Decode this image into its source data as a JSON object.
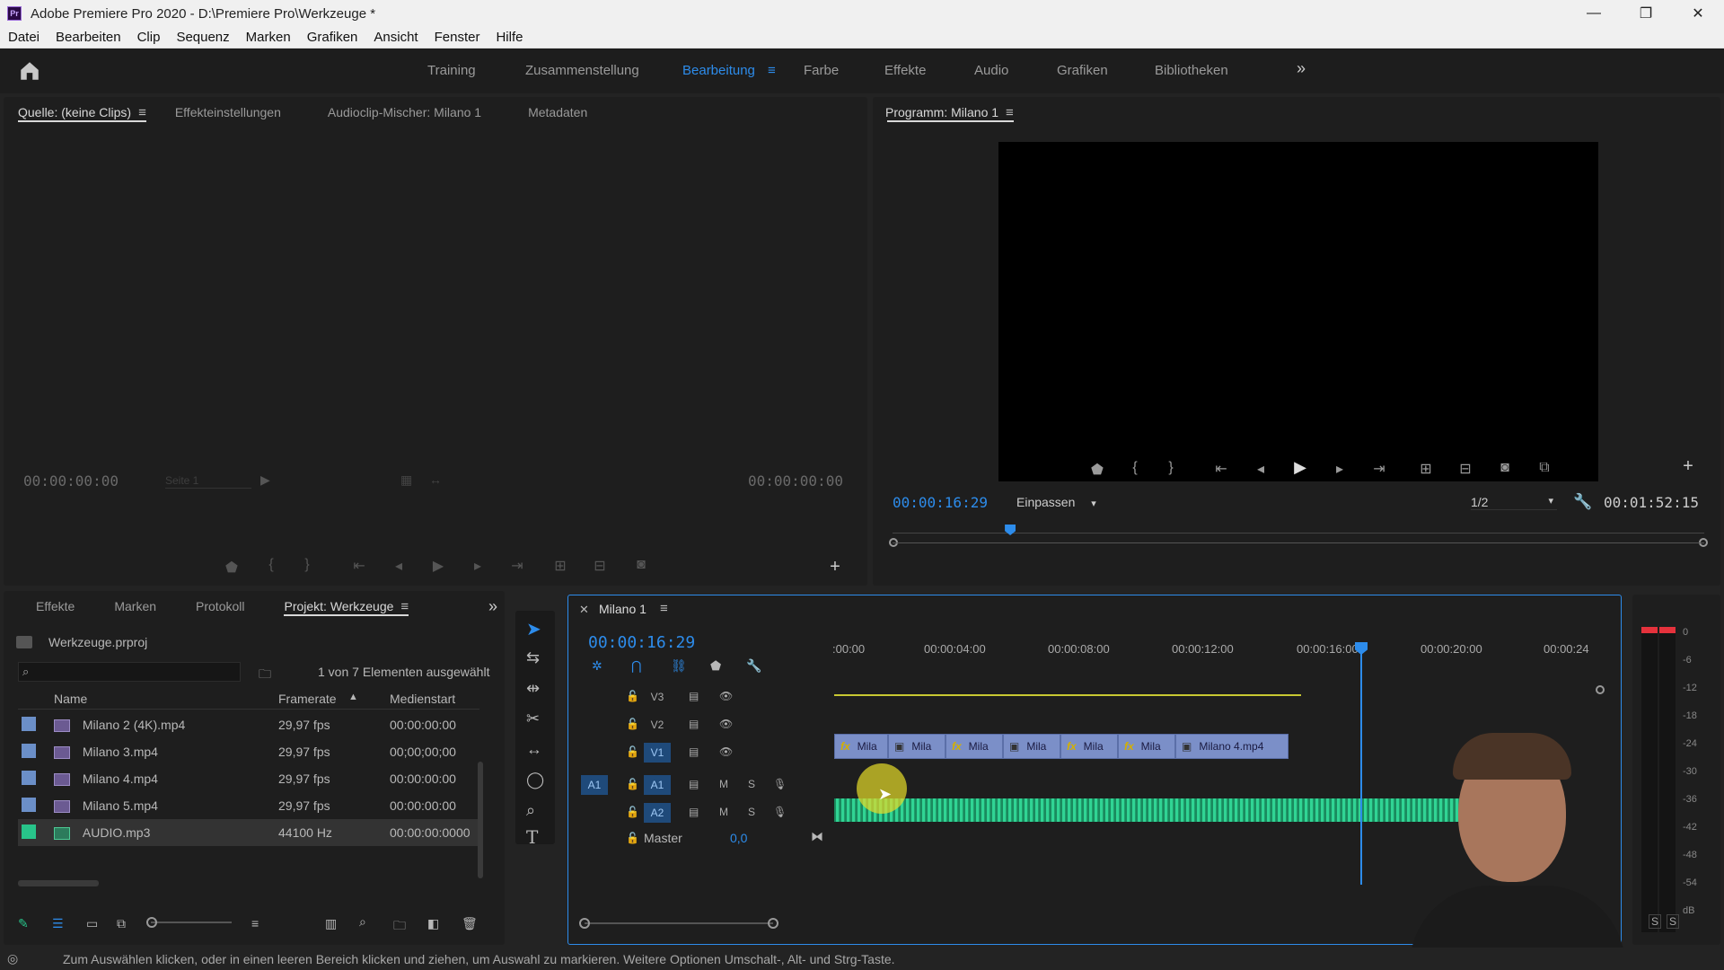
{
  "app": {
    "title": "Adobe Premiere Pro 2020 - D:\\Premiere Pro\\Werkzeuge *",
    "icon": "Pr"
  },
  "window_controls": {
    "minimize": "—",
    "maximize": "❐",
    "close": "✕"
  },
  "menu": [
    "Datei",
    "Bearbeiten",
    "Clip",
    "Sequenz",
    "Marken",
    "Grafiken",
    "Ansicht",
    "Fenster",
    "Hilfe"
  ],
  "workspaces": {
    "items": [
      "Training",
      "Zusammenstellung",
      "Bearbeitung",
      "Farbe",
      "Effekte",
      "Audio",
      "Grafiken",
      "Bibliotheken"
    ],
    "active": "Bearbeitung",
    "overflow": "»"
  },
  "source_panel": {
    "tabs": [
      "Quelle: (keine Clips)",
      "Effekteinstellungen",
      "Audioclip-Mischer: Milano 1",
      "Metadaten"
    ],
    "timecode_left": "00:00:00:00",
    "page_label": "Seite 1",
    "timecode_right": "00:00:00:00"
  },
  "program_panel": {
    "title": "Programm: Milano 1",
    "timecode": "00:00:16:29",
    "fit": "Einpassen",
    "resolution": "1/2",
    "duration": "00:01:52:15",
    "playhead_fraction": 0.145
  },
  "project_panel": {
    "tabs": [
      "Effekte",
      "Marken",
      "Protokoll",
      "Projekt: Werkzeuge"
    ],
    "active_tab": "Projekt: Werkzeuge",
    "file": "Werkzeuge.prproj",
    "selection_status": "1 von 7 Elementen ausgewählt",
    "columns": [
      "Name",
      "Framerate",
      "Medienstart"
    ],
    "rows": [
      {
        "name": "Milano 2 (4K).mp4",
        "framerate": "29,97 fps",
        "start": "00:00:00:00",
        "color": "#6b8fc8"
      },
      {
        "name": "Milano 3.mp4",
        "framerate": "29,97 fps",
        "start": "00;00;00;00",
        "color": "#6b8fc8"
      },
      {
        "name": "Milano 4.mp4",
        "framerate": "29,97 fps",
        "start": "00:00:00:00",
        "color": "#6b8fc8"
      },
      {
        "name": "Milano 5.mp4",
        "framerate": "29,97 fps",
        "start": "00:00:00:00",
        "color": "#6b8fc8"
      },
      {
        "name": "AUDIO.mp3",
        "framerate": "44100  Hz",
        "start": "00:00:00:0000",
        "color": "#28c48a"
      }
    ]
  },
  "timeline": {
    "sequence": "Milano 1",
    "timecode": "00:00:16:29",
    "ruler": [
      ":00:00",
      "00:00:04:00",
      "00:00:08:00",
      "00:00:12:00",
      "00:00:16:00",
      "00:00:20:00",
      "00:00:24"
    ],
    "tracks_video": [
      "V3",
      "V2",
      "V1"
    ],
    "tracks_audio": [
      "A1",
      "A2"
    ],
    "source_patch": "A1",
    "mute": "M",
    "solo": "S",
    "master_label": "Master",
    "master_value": "0,0",
    "clips": [
      {
        "label": "Mila",
        "fx": "fx"
      },
      {
        "label": "Mila",
        "fx": ""
      },
      {
        "label": "Mila",
        "fx": "fx"
      },
      {
        "label": "Mila",
        "fx": ""
      },
      {
        "label": "Mila",
        "fx": "fx"
      },
      {
        "label": "Mila",
        "fx": "fx"
      },
      {
        "label": "Milano 4.mp4",
        "fx": ""
      }
    ]
  },
  "audio_meter": {
    "scale": [
      "0",
      "-6",
      "-12",
      "-18",
      "-24",
      "-30",
      "-36",
      "-42",
      "-48",
      "-54",
      "dB"
    ],
    "solo_left": "S",
    "solo_right": "S"
  },
  "status_bar": "Zum Auswählen klicken, oder in einen leeren Bereich klicken und ziehen, um Auswahl zu markieren. Weitere Optionen Umschalt-, Alt- und Strg-Taste.",
  "colors": {
    "accent": "#2d8ceb",
    "clip_video": "#7b8fc8",
    "clip_audio": "#28c48a",
    "playhead": "#2d8ceb"
  }
}
